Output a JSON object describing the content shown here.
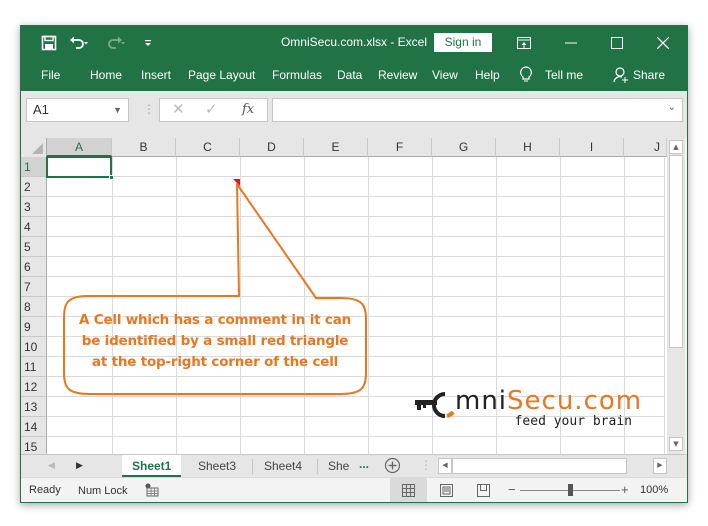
{
  "titlebar": {
    "title": "OmniSecu.com.xlsx  -  Excel",
    "sign_in": "Sign in",
    "icons": [
      "save-icon",
      "undo-icon",
      "redo-icon",
      "customize-qat-icon",
      "ribbon-display-icon",
      "minimize-icon",
      "maximize-icon",
      "close-icon"
    ]
  },
  "menu": {
    "items": [
      "File",
      "Home",
      "Insert",
      "Page Layout",
      "Formulas",
      "Data",
      "Review",
      "View",
      "Help"
    ],
    "tell_me": "Tell me",
    "share": "Share"
  },
  "formula_bar": {
    "name_box": "A1",
    "fx_label": "fx",
    "formula_value": ""
  },
  "grid": {
    "columns": [
      "A",
      "B",
      "C",
      "D",
      "E",
      "F",
      "G",
      "H",
      "I",
      "J"
    ],
    "rows": [
      "1",
      "2",
      "3",
      "4",
      "5",
      "6",
      "7",
      "8",
      "9",
      "10",
      "11",
      "12",
      "13",
      "14",
      "15"
    ],
    "selected_cell": "A1",
    "comment_cell": "C2",
    "comment_indicator_color": "#e81123"
  },
  "callout": {
    "lines": [
      "A Cell which has a comment in it can",
      "be identified by a small red triangle",
      "at the top-right corner of the cell"
    ],
    "color": "#e87722"
  },
  "logo": {
    "part1": "mni",
    "part2": "Secu.com",
    "tagline": "feed your brain"
  },
  "sheets": {
    "tabs": [
      "Sheet1",
      "Sheet3",
      "Sheet4",
      "She"
    ],
    "active": "Sheet1",
    "more": "..."
  },
  "status": {
    "ready": "Ready",
    "num_lock": "Num Lock",
    "zoom": "100%",
    "zoom_percent": 100
  },
  "colors": {
    "accent": "#217346",
    "callout": "#e87722"
  }
}
